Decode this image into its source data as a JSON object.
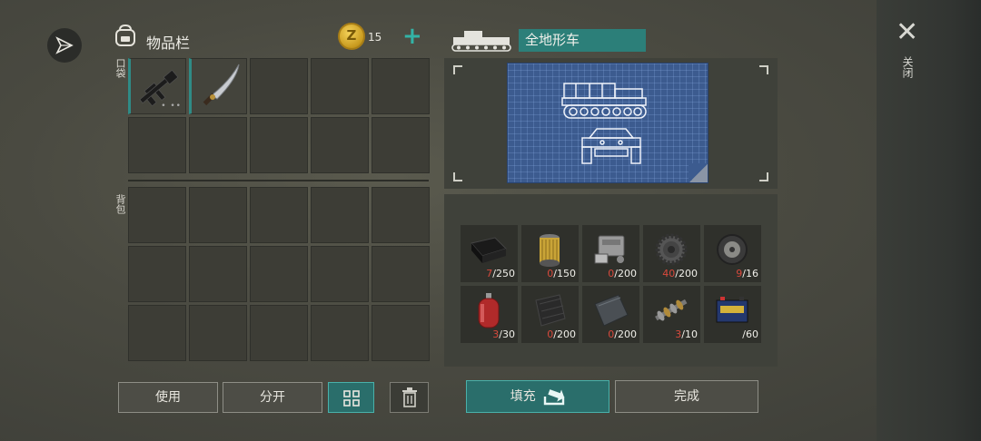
{
  "header": {
    "inventory_title": "物品栏",
    "coin_icon_letter": "Z",
    "coin_count": "15",
    "add_label": "+"
  },
  "inventory": {
    "pocket_label": "口袋",
    "backpack_label": "背包",
    "pocket_items": [
      "assault-rifle",
      "machete",
      "",
      "",
      "",
      "",
      "",
      "",
      "",
      ""
    ],
    "backpack_slots": 15
  },
  "actions": {
    "use_label": "使用",
    "split_label": "分开",
    "grid_view_icon": "grid-icon",
    "trash_icon": "trash-icon"
  },
  "vehicle": {
    "name": "全地形车"
  },
  "materials": [
    {
      "icon": "rubber-sheet",
      "have": "7",
      "need": "/250"
    },
    {
      "icon": "oil-filter",
      "have": "0",
      "need": "/150"
    },
    {
      "icon": "engine-block",
      "have": "0",
      "need": "/200"
    },
    {
      "icon": "gear",
      "have": "40",
      "need": "/200"
    },
    {
      "icon": "wheel-rim",
      "have": "9",
      "need": "/16"
    },
    {
      "icon": "gas-cylinder",
      "have": "3",
      "need": "/30"
    },
    {
      "icon": "carbon-fiber",
      "have": "0",
      "need": "/200"
    },
    {
      "icon": "metal-plate",
      "have": "0",
      "need": "/200"
    },
    {
      "icon": "camshaft",
      "have": "3",
      "need": "/10"
    },
    {
      "icon": "car-battery",
      "have": "",
      "need": "/60"
    }
  ],
  "craft": {
    "fill_label": "填充",
    "complete_label": "完成"
  },
  "close": {
    "icon": "close-icon",
    "label": "关闭"
  },
  "colors": {
    "accent": "#2c7f79",
    "deficit": "#d9493c",
    "blueprint": "#3c5b8f"
  }
}
